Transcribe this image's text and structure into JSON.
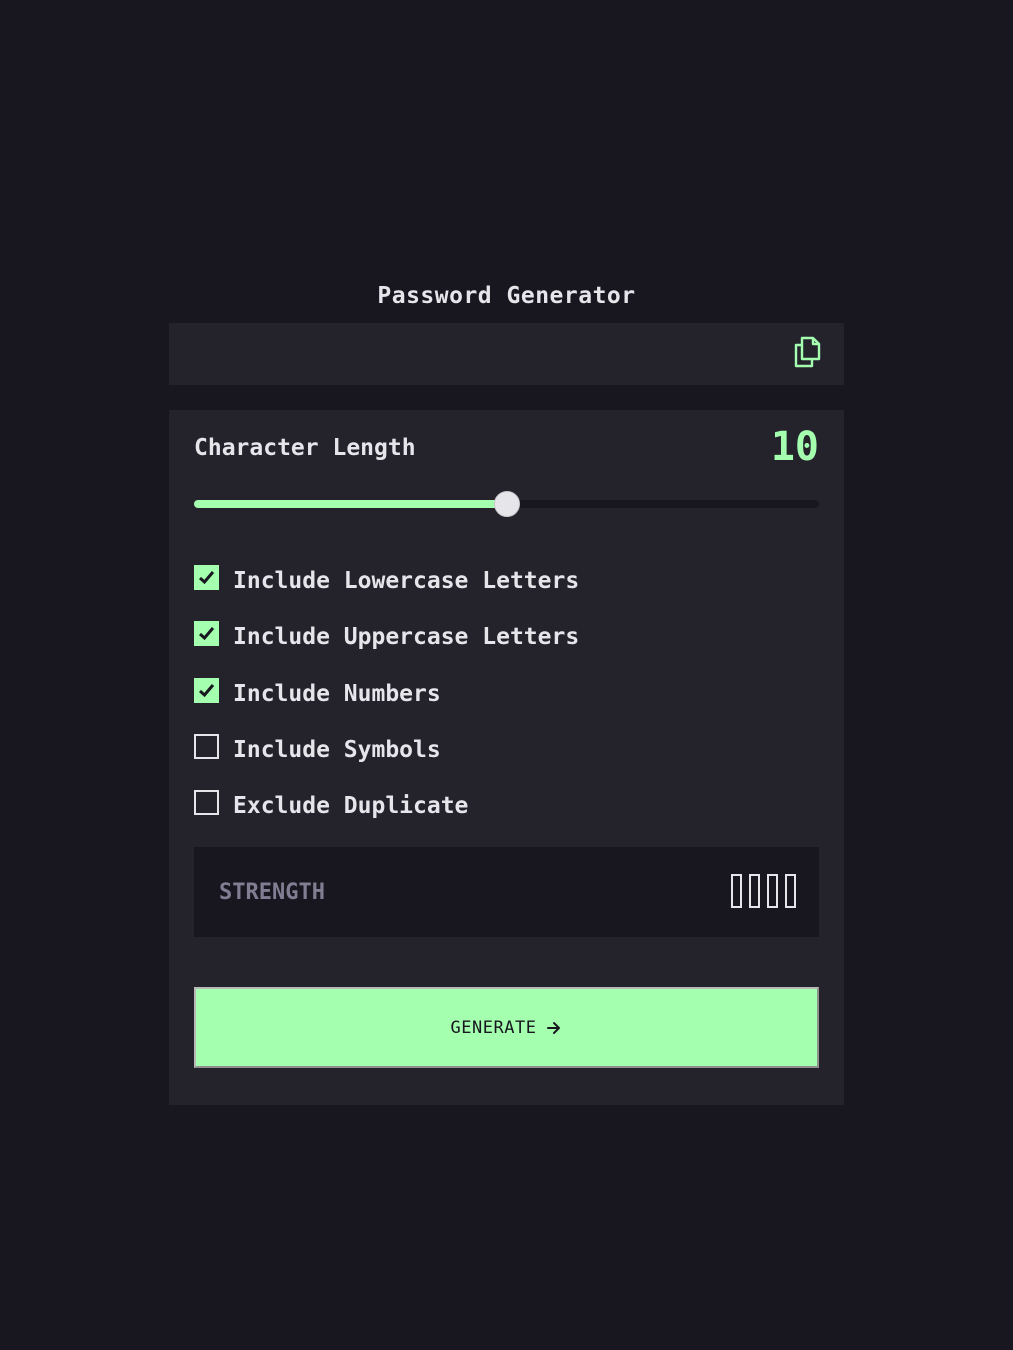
{
  "app": {
    "title": "Password Generator"
  },
  "output": {
    "password": "",
    "copy_icon": "copy-icon"
  },
  "length": {
    "label": "Character Length",
    "value": "10",
    "min": 0,
    "max": 20,
    "current": 10
  },
  "options": [
    {
      "label": "Include Lowercase Letters",
      "checked": true
    },
    {
      "label": "Include Uppercase Letters",
      "checked": true
    },
    {
      "label": "Include Numbers",
      "checked": true
    },
    {
      "label": "Include Symbols",
      "checked": false
    },
    {
      "label": "Exclude Duplicate",
      "checked": false
    }
  ],
  "strength": {
    "label": "STRENGTH",
    "level": 0,
    "bars": 4
  },
  "generate": {
    "label": "GENERATE",
    "icon": "arrow-right-icon"
  },
  "colors": {
    "background": "#18171f",
    "panel": "#24232c",
    "accent": "#a4ffaf",
    "text": "#e6e5ea",
    "muted": "#817d92"
  }
}
